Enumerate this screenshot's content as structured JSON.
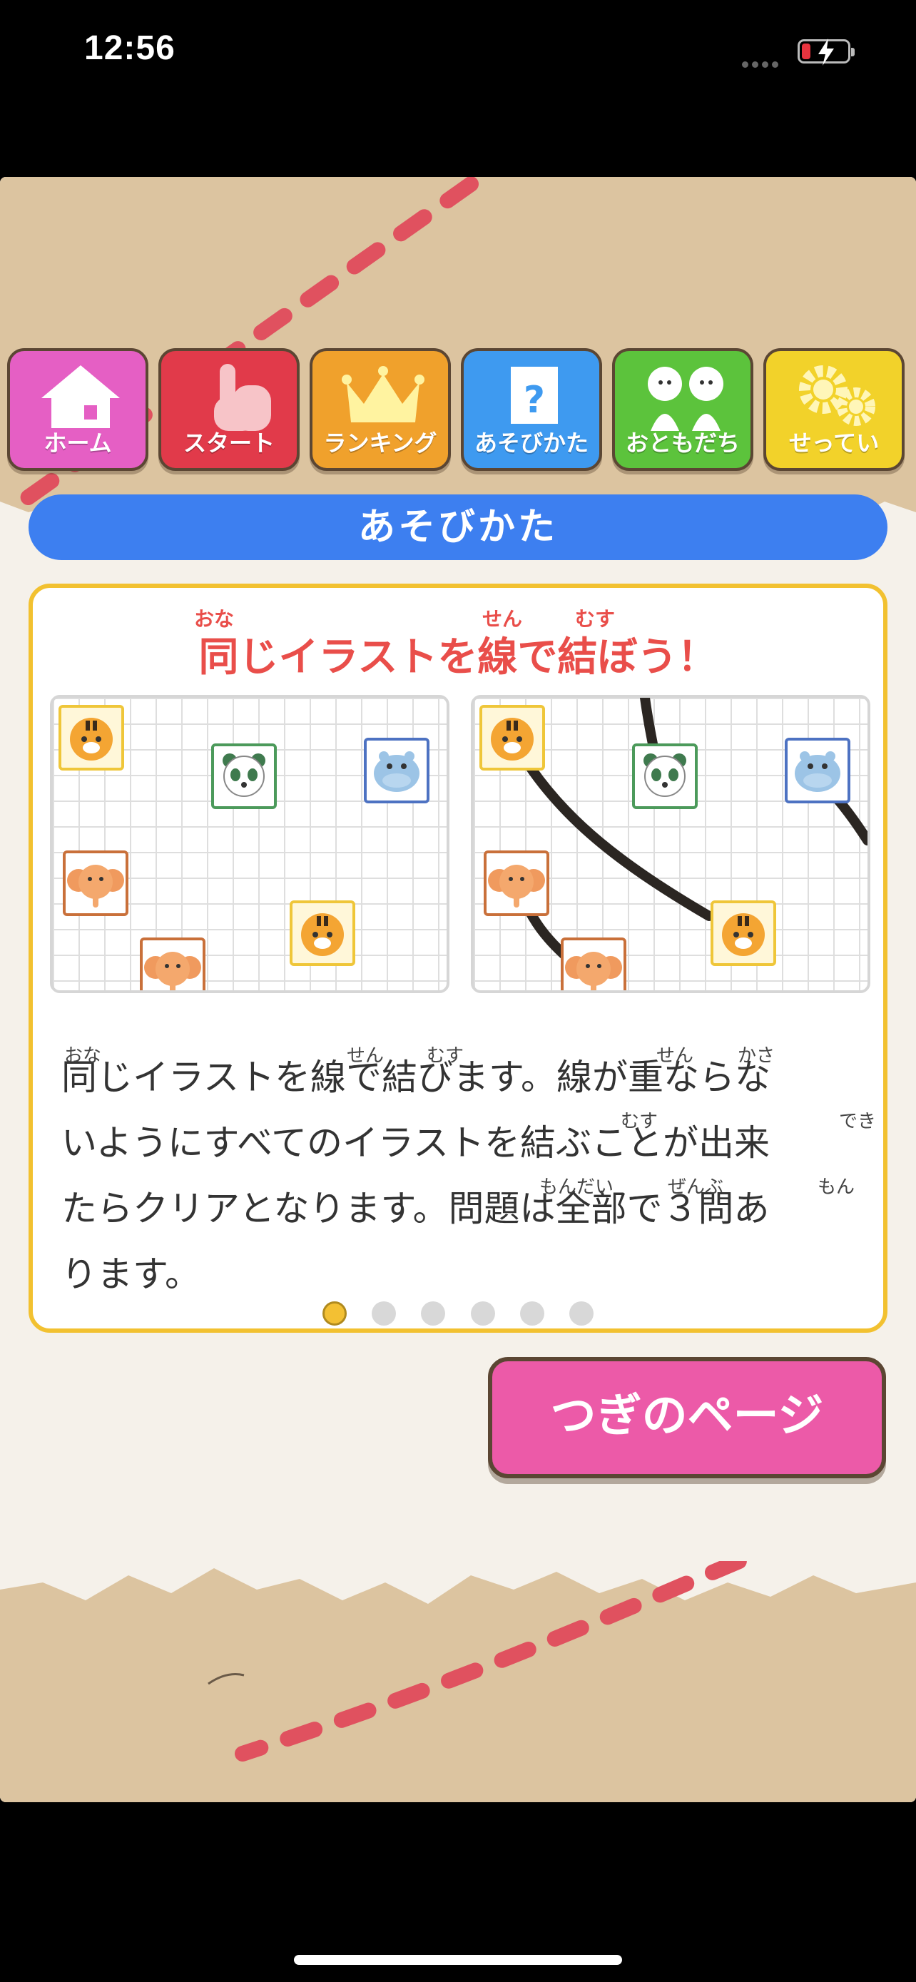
{
  "status_bar": {
    "time": "12:56",
    "battery_color": "#e8343f"
  },
  "nav": {
    "items": [
      {
        "label": "ホーム",
        "icon": "house-icon",
        "color": "#e55fc4"
      },
      {
        "label": "スタート",
        "icon": "pointer-hand-icon",
        "color": "#e13a4a"
      },
      {
        "label": "ランキング",
        "icon": "crown-icon",
        "color": "#f0a12c"
      },
      {
        "label": "あそびかた",
        "icon": "question-icon",
        "color": "#3e9af0"
      },
      {
        "label": "おともだち",
        "icon": "friends-icon",
        "color": "#5cc33c"
      },
      {
        "label": "せってい",
        "icon": "gears-icon",
        "color": "#f2d22a"
      }
    ]
  },
  "page_title": "あそびかた",
  "card": {
    "headline": "同じイラストを線で結ぼう！",
    "headline_ruby": {
      "r1": "おな",
      "r2": "せん",
      "r3": "むす"
    },
    "example_left_animals": [
      "tiger",
      "panda",
      "hippo",
      "elephant",
      "tiger",
      "elephant"
    ],
    "example_right_animals": [
      "tiger",
      "panda",
      "hippo",
      "elephant",
      "tiger",
      "elephant"
    ],
    "description_lines": [
      "同じイラストを線で結びます。線が重ならな",
      "いようにすべてのイラストを結ぶことが出来",
      "たらクリアとなります。問題は全部で３問あ",
      "ります。"
    ],
    "description_ruby": {
      "l1a": "おな",
      "l1b": "せん",
      "l1c": "むす",
      "l1d": "せん",
      "l1e": "かさ",
      "l2a": "むす",
      "l2b": "でき",
      "l3a": "もんだい",
      "l3b": "ぜんぶ",
      "l3c": "もん"
    },
    "page_dots": {
      "total": 6,
      "active": 1
    }
  },
  "next_button": "つぎのページ",
  "colors": {
    "accent_blue": "#3d7ff0",
    "card_border": "#f2c130",
    "headline": "#e94e4a",
    "next_pink": "#ec5aa8"
  }
}
